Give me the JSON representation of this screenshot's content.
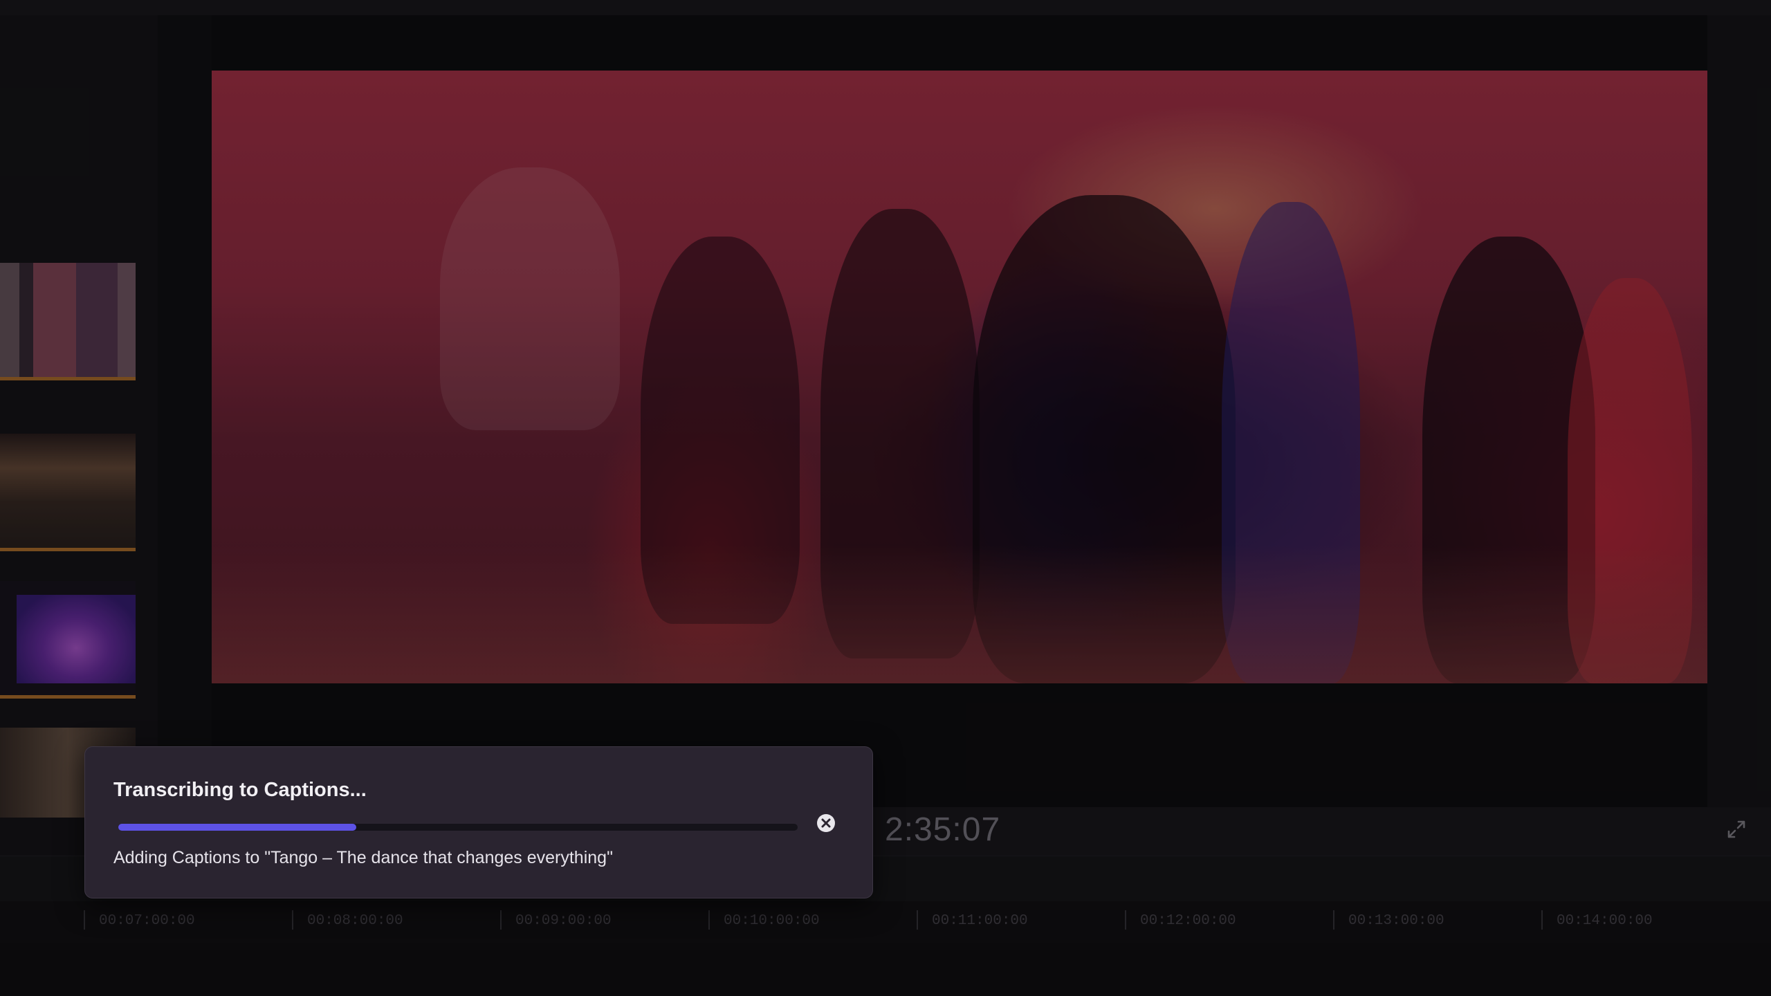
{
  "viewer": {
    "timecode": "2:35:07"
  },
  "dialog": {
    "title": "Transcribing to Captions...",
    "subtitle": "Adding Captions to \"Tango – The dance that changes everything\"",
    "progress": 0.35,
    "accent_color": "#5d52e6"
  },
  "timeline": {
    "ruler_labels": [
      "00:07:00:00",
      "00:08:00:00",
      "00:09:00:00",
      "00:10:00:00",
      "00:11:00:00",
      "00:12:00:00",
      "00:13:00:00",
      "00:14:00:00"
    ]
  },
  "icons": {
    "cancel": "close-circle-icon",
    "fullscreen": "expand-arrows-icon"
  }
}
